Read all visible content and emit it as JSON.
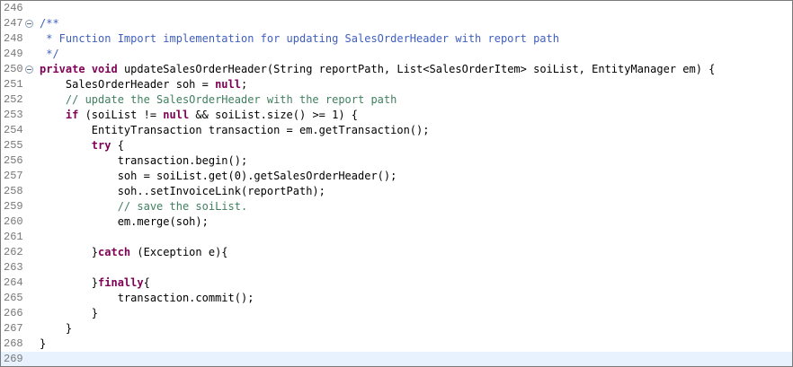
{
  "editor": {
    "lines": [
      {
        "num": "246",
        "segments": []
      },
      {
        "num": "247",
        "fold": true,
        "segments": [
          {
            "t": "jd",
            "v": "/**"
          }
        ]
      },
      {
        "num": "248",
        "segments": [
          {
            "t": "jd",
            "v": " * Function Import implementation for updating SalesOrderHeader with report path"
          }
        ]
      },
      {
        "num": "249",
        "segments": [
          {
            "t": "jd",
            "v": " */"
          }
        ]
      },
      {
        "num": "250",
        "fold": true,
        "segments": [
          {
            "t": "kw",
            "v": "private"
          },
          {
            "t": "p",
            "v": " "
          },
          {
            "t": "kw",
            "v": "void"
          },
          {
            "t": "p",
            "v": " updateSalesOrderHeader(String reportPath, List<SalesOrderItem> soiList, EntityManager em) {"
          }
        ]
      },
      {
        "num": "251",
        "segments": [
          {
            "t": "p",
            "v": "    SalesOrderHeader soh = "
          },
          {
            "t": "kw",
            "v": "null"
          },
          {
            "t": "p",
            "v": ";"
          }
        ]
      },
      {
        "num": "252",
        "segments": [
          {
            "t": "cm",
            "v": "    // update the SalesOrderHeader with the report path"
          }
        ]
      },
      {
        "num": "253",
        "segments": [
          {
            "t": "p",
            "v": "    "
          },
          {
            "t": "kw",
            "v": "if"
          },
          {
            "t": "p",
            "v": " (soiList != "
          },
          {
            "t": "kw",
            "v": "null"
          },
          {
            "t": "p",
            "v": " && soiList.size() >= 1) {"
          }
        ]
      },
      {
        "num": "254",
        "segments": [
          {
            "t": "p",
            "v": "        EntityTransaction transaction = em.getTransaction();"
          }
        ]
      },
      {
        "num": "255",
        "segments": [
          {
            "t": "p",
            "v": "        "
          },
          {
            "t": "kw",
            "v": "try"
          },
          {
            "t": "p",
            "v": " {"
          }
        ]
      },
      {
        "num": "256",
        "segments": [
          {
            "t": "p",
            "v": "            transaction.begin();"
          }
        ]
      },
      {
        "num": "257",
        "segments": [
          {
            "t": "p",
            "v": "            soh = soiList.get(0).getSalesOrderHeader();"
          }
        ]
      },
      {
        "num": "258",
        "segments": [
          {
            "t": "p",
            "v": "            soh..setInvoiceLink(reportPath);"
          }
        ]
      },
      {
        "num": "259",
        "segments": [
          {
            "t": "cm",
            "v": "            // save the soiList."
          }
        ]
      },
      {
        "num": "260",
        "segments": [
          {
            "t": "p",
            "v": "            em.merge(soh);"
          }
        ]
      },
      {
        "num": "261",
        "segments": []
      },
      {
        "num": "262",
        "segments": [
          {
            "t": "p",
            "v": "        }"
          },
          {
            "t": "kw",
            "v": "catch"
          },
          {
            "t": "p",
            "v": " (Exception e){"
          }
        ]
      },
      {
        "num": "263",
        "segments": []
      },
      {
        "num": "264",
        "segments": [
          {
            "t": "p",
            "v": "        }"
          },
          {
            "t": "kw",
            "v": "finally"
          },
          {
            "t": "p",
            "v": "{"
          }
        ]
      },
      {
        "num": "265",
        "segments": [
          {
            "t": "p",
            "v": "            transaction.commit();"
          }
        ]
      },
      {
        "num": "266",
        "segments": [
          {
            "t": "p",
            "v": "        }"
          }
        ]
      },
      {
        "num": "267",
        "segments": [
          {
            "t": "p",
            "v": "    }"
          }
        ]
      },
      {
        "num": "268",
        "segments": [
          {
            "t": "p",
            "v": "}"
          }
        ]
      },
      {
        "num": "269",
        "current": true,
        "segments": []
      }
    ]
  },
  "colors": {
    "keyword": "#7f0055",
    "comment": "#3f7f5f",
    "javadoc": "#3f5fbf",
    "line_number": "#787878",
    "current_line": "#e8f2fe"
  },
  "icons": {
    "fold": "fold-minus-icon"
  }
}
